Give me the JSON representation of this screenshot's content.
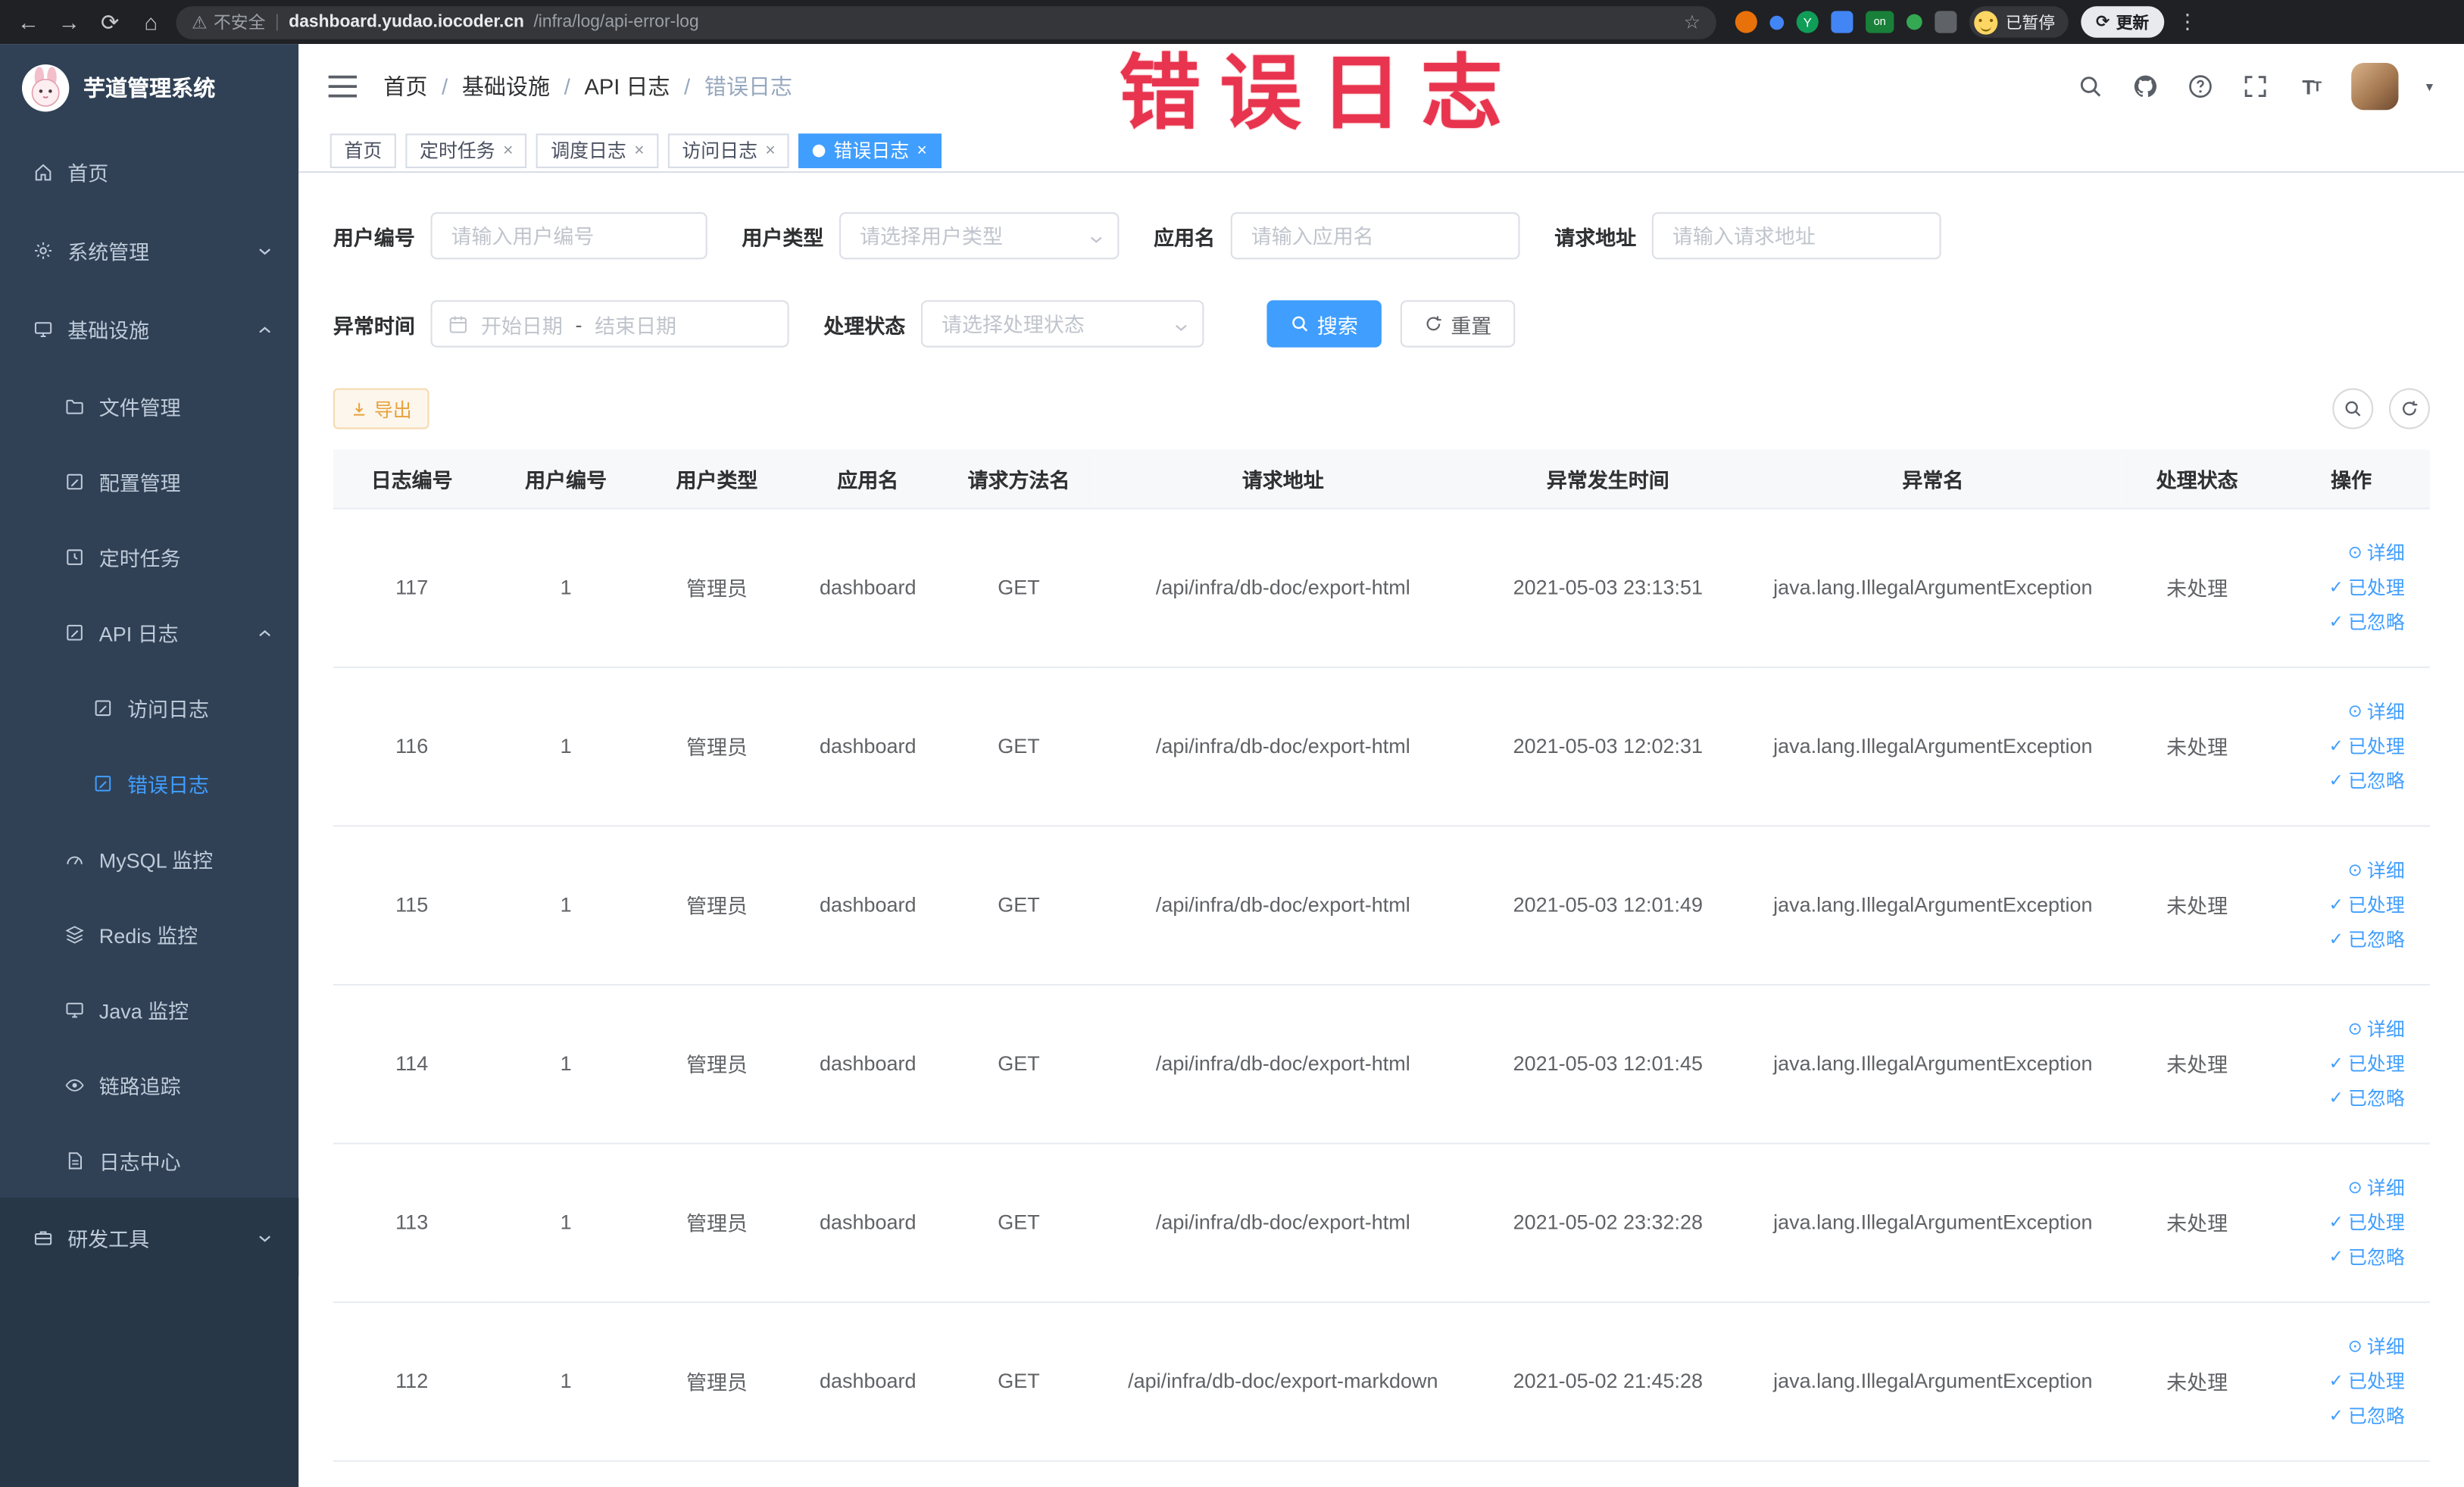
{
  "browser": {
    "security_label": "不安全",
    "url_host": "dashboard.yudao.iocoder.cn",
    "url_path": "/infra/log/api-error-log",
    "extension_badge": "on",
    "extension_letter": "Y",
    "profile_status": "已暂停",
    "update_label": "更新"
  },
  "annotation": {
    "text": "错误日志",
    "color": "#e8344e"
  },
  "sidebar": {
    "app_title": "芋道管理系统",
    "items": [
      {
        "label": "首页"
      },
      {
        "label": "系统管理"
      },
      {
        "label": "基础设施"
      },
      {
        "label": "文件管理"
      },
      {
        "label": "配置管理"
      },
      {
        "label": "定时任务"
      },
      {
        "label": "API 日志"
      },
      {
        "label": "访问日志"
      },
      {
        "label": "错误日志"
      },
      {
        "label": "MySQL 监控"
      },
      {
        "label": "Redis 监控"
      },
      {
        "label": "Java 监控"
      },
      {
        "label": "链路追踪"
      },
      {
        "label": "日志中心"
      },
      {
        "label": "研发工具"
      }
    ]
  },
  "header": {
    "breadcrumb": [
      "首页",
      "基础设施",
      "API 日志",
      "错误日志"
    ]
  },
  "tabs": [
    {
      "label": "首页"
    },
    {
      "label": "定时任务"
    },
    {
      "label": "调度日志"
    },
    {
      "label": "访问日志"
    },
    {
      "label": "错误日志"
    }
  ],
  "filters": {
    "user_id": {
      "label": "用户编号",
      "placeholder": "请输入用户编号"
    },
    "user_type": {
      "label": "用户类型",
      "placeholder": "请选择用户类型"
    },
    "app_name": {
      "label": "应用名",
      "placeholder": "请输入应用名"
    },
    "request_url": {
      "label": "请求地址",
      "placeholder": "请输入请求地址"
    },
    "exception_time": {
      "label": "异常时间",
      "start_placeholder": "开始日期",
      "end_placeholder": "结束日期",
      "separator": "-"
    },
    "process_status": {
      "label": "处理状态",
      "placeholder": "请选择处理状态"
    },
    "search_label": "搜索",
    "reset_label": "重置"
  },
  "toolbar": {
    "export_label": "导出"
  },
  "table": {
    "columns": [
      "日志编号",
      "用户编号",
      "用户类型",
      "应用名",
      "请求方法名",
      "请求地址",
      "异常发生时间",
      "异常名",
      "处理状态",
      "操作"
    ],
    "action_labels": {
      "detail": "详细",
      "processed": "已处理",
      "ignored": "已忽略"
    },
    "rows": [
      {
        "log_id": "117",
        "user_id": "1",
        "user_type": "管理员",
        "app_name": "dashboard",
        "method": "GET",
        "url": "/api/infra/db-doc/export-html",
        "time": "2021-05-03 23:13:51",
        "exception": "java.lang.IllegalArgumentException",
        "status": "未处理"
      },
      {
        "log_id": "116",
        "user_id": "1",
        "user_type": "管理员",
        "app_name": "dashboard",
        "method": "GET",
        "url": "/api/infra/db-doc/export-html",
        "time": "2021-05-03 12:02:31",
        "exception": "java.lang.IllegalArgumentException",
        "status": "未处理"
      },
      {
        "log_id": "115",
        "user_id": "1",
        "user_type": "管理员",
        "app_name": "dashboard",
        "method": "GET",
        "url": "/api/infra/db-doc/export-html",
        "time": "2021-05-03 12:01:49",
        "exception": "java.lang.IllegalArgumentException",
        "status": "未处理"
      },
      {
        "log_id": "114",
        "user_id": "1",
        "user_type": "管理员",
        "app_name": "dashboard",
        "method": "GET",
        "url": "/api/infra/db-doc/export-html",
        "time": "2021-05-03 12:01:45",
        "exception": "java.lang.IllegalArgumentException",
        "status": "未处理"
      },
      {
        "log_id": "113",
        "user_id": "1",
        "user_type": "管理员",
        "app_name": "dashboard",
        "method": "GET",
        "url": "/api/infra/db-doc/export-html",
        "time": "2021-05-02 23:32:28",
        "exception": "java.lang.IllegalArgumentException",
        "status": "未处理"
      },
      {
        "log_id": "112",
        "user_id": "1",
        "user_type": "管理员",
        "app_name": "dashboard",
        "method": "GET",
        "url": "/api/infra/db-doc/export-markdown",
        "time": "2021-05-02 21:45:28",
        "exception": "java.lang.IllegalArgumentException",
        "status": "未处理"
      }
    ]
  },
  "icons": {
    "back": "←",
    "forward": "→",
    "reload": "⟳",
    "home": "⌂",
    "warning": "⚠",
    "star": "☆",
    "kebab": "⋮",
    "check": "✓",
    "detail": "⊙",
    "caret": "▾",
    "update": "⟳"
  },
  "colors": {
    "accent": "#409eff",
    "sidebar_bg": "#304156",
    "sidebar_text": "#bfcbd9",
    "annotation": "#e8344e",
    "export_text": "#e6a23c",
    "export_bg": "#fdf6ec",
    "export_border": "#f5dab1"
  }
}
